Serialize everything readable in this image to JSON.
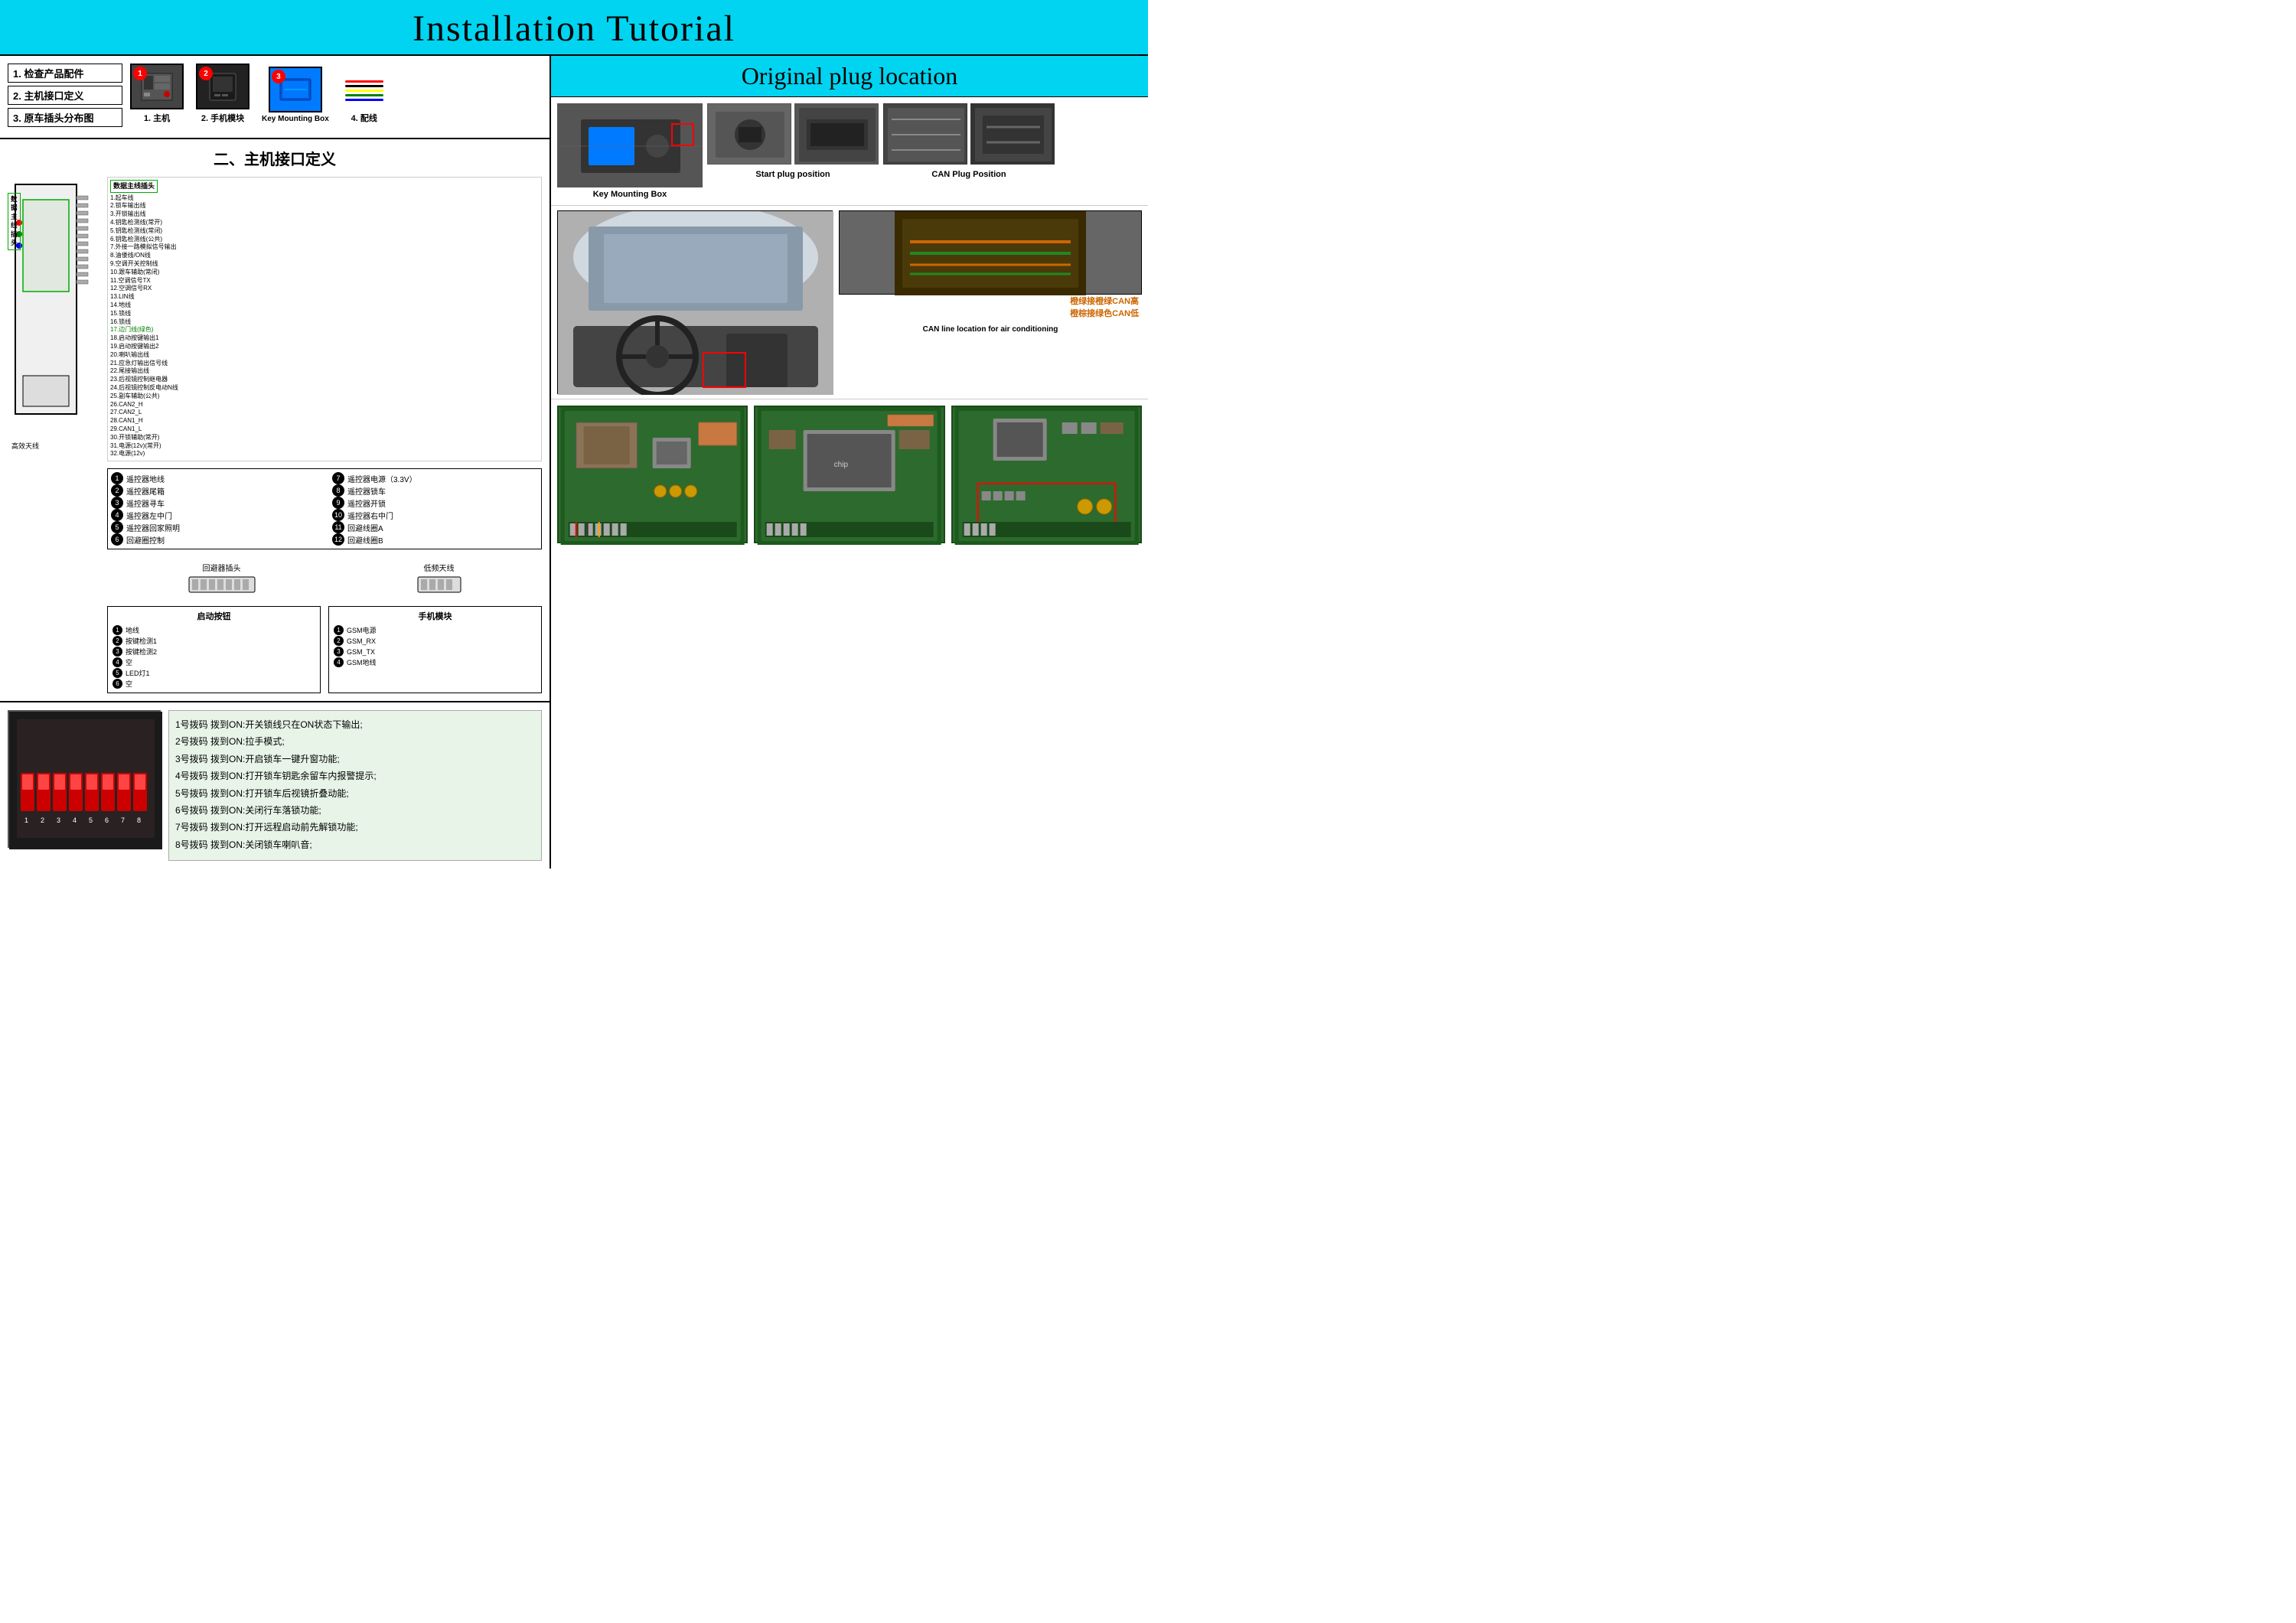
{
  "header": {
    "title": "Installation Tutorial"
  },
  "left": {
    "checklist": {
      "items": [
        "1. 检查产品配件",
        "2. 主机接口定义",
        "3. 原车插头分布图"
      ]
    },
    "components": [
      {
        "id": 1,
        "label": "1. 主机",
        "type": "main-unit"
      },
      {
        "id": 2,
        "label": "2. 手机模块",
        "type": "phone-module"
      },
      {
        "id": 3,
        "label": "Key Mounting Box",
        "type": "key-mount"
      },
      {
        "id": 4,
        "label": "4. 配线",
        "type": "wiring"
      }
    ],
    "section_title": "二、主机接口定义",
    "interface_numbers": [
      {
        "num": 1,
        "label": "遥控器地线"
      },
      {
        "num": 2,
        "label": "遥控器尾箱"
      },
      {
        "num": 3,
        "label": "遥控器寻车"
      },
      {
        "num": 4,
        "label": "遥控器左中门"
      },
      {
        "num": 5,
        "label": "遥控器回家照明"
      },
      {
        "num": 6,
        "label": "回避圈控制"
      },
      {
        "num": 7,
        "label": "遥控器电源（3.3V）"
      },
      {
        "num": 8,
        "label": "遥控器锁车"
      },
      {
        "num": 9,
        "label": "遥控器开锁"
      },
      {
        "num": 10,
        "label": "遥控器右中门"
      },
      {
        "num": 11,
        "label": "回避线圈A"
      },
      {
        "num": 12,
        "label": "回避线圈B"
      }
    ],
    "left_connector_labels": [
      "1.起车线",
      "2.锁车输出线",
      "3.开锁输出线",
      "4.钥匙检测线(常开)",
      "5.钥匙检测线(常闭)",
      "6.明匙检测线(公共)",
      "7.外接一路模拟信号输出",
      "8.油偻线/ON线",
      "9.空调开关控制线",
      "10.跟车辅助(常闭)",
      "11.空调信号TX",
      "12.空调信号RX",
      "13.LIN线",
      "14.地线",
      "15.锁线",
      "16.锁线",
      "17.边门线",
      "(绿色)",
      "18.启动按键输出1",
      "19.启动按键输出2",
      "20.喇叭输出线",
      "21.应急灯输出信号线",
      "22.尾接输出线",
      "23.后视镜控制继电器",
      "24.后视镜控制反电动N线",
      "25.副车辅助(公共)",
      "26.CAN2_H",
      "27.CAN2_L",
      "28.CAN1_H",
      "29.CAN1_L",
      "30.开锁辅助(常开)",
      "31.电源(12v)(常开)",
      "32.电源(12v)"
    ],
    "plug_labels": [
      "回避器插头",
      "低频天线"
    ],
    "start_button_items": [
      {
        "num": 1,
        "label": "地线"
      },
      {
        "num": 2,
        "label": "按键检测1"
      },
      {
        "num": 3,
        "label": "按键检测2"
      },
      {
        "num": 4,
        "label": "空"
      },
      {
        "num": 5,
        "label": "LED灯1"
      },
      {
        "num": 6,
        "label": "空"
      }
    ],
    "phone_module_items": [
      {
        "num": 1,
        "label": "GSM电源"
      },
      {
        "num": 2,
        "label": "GSM_RX"
      },
      {
        "num": 3,
        "label": "GSM_TX"
      },
      {
        "num": 4,
        "label": "GSM地线"
      }
    ],
    "start_button_title": "启动按钮",
    "phone_module_title": "手机模块",
    "dip_switches": {
      "description": [
        "1号拨码 拨到ON:开关锁线只在ON状态下输出;",
        "2号拨码 拨到ON:拉手模式;",
        "3号拨码 拨到ON:开启锁车一键升窗功能;",
        "4号拨码 拨到ON:打开锁车钥匙余留车内报警提示;",
        "5号拨码 拨到ON:打开锁车后视镜折叠动能;",
        "6号拨码 拨到ON:关闭行车落锁功能;",
        "7号拨码 拨到ON:打开远程启动前先解锁功能;",
        "8号拨码 拨到ON:关闭锁车喇叭音;"
      ]
    }
  },
  "right": {
    "header": "Original plug location",
    "labels": {
      "key_mounting_box": "Key Mounting Box",
      "start_plug": "Start plug position",
      "can_plug": "CAN Plug Position",
      "can_line": "CAN line location for air conditioning",
      "orange_high": "橙绿接橙绿CAN高",
      "orange_low": "橙棕接绿色CAN低"
    }
  }
}
